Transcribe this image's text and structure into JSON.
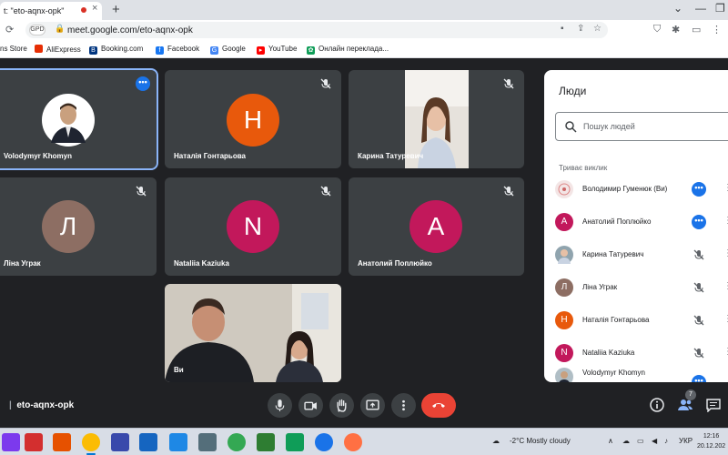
{
  "browser": {
    "tab_title": "t: \"eto-aqnx-opk\"",
    "tab_close": "×",
    "new_tab": "+",
    "url": "meet.google.com/eto-aqnx-opk",
    "site_badge": "GPD",
    "minimize": "—",
    "restore": "❐"
  },
  "bookmarks": [
    {
      "label": "ns Store",
      "color": "#4285f4"
    },
    {
      "label": "AliExpress",
      "color": "#e62e04"
    },
    {
      "label": "Booking.com",
      "color": "#003580"
    },
    {
      "label": "Facebook",
      "color": "#1877f2"
    },
    {
      "label": "Google",
      "color": "#4285f4"
    },
    {
      "label": "YouTube",
      "color": "#ff0000"
    },
    {
      "label": "Онлайн переклада...",
      "color": "#0f9d58"
    }
  ],
  "tiles": [
    {
      "name": "Volodymyr Khomyn",
      "kind": "photo",
      "active": true,
      "menu": "•••"
    },
    {
      "name": "Наталія Гонтарьова",
      "initial": "Н",
      "color": "#e8590c",
      "muted": true
    },
    {
      "name": "Карина Татуревич",
      "kind": "video",
      "muted": true
    },
    {
      "name": "Ліна Уграк",
      "initial": "Л",
      "color": "#8d6e63",
      "muted": true
    },
    {
      "name": "Nataliia Kaziuka",
      "initial": "N",
      "color": "#c2185b",
      "muted": true
    },
    {
      "name": "Анатолий Поплюйко",
      "initial": "А",
      "color": "#c2185b",
      "muted": true
    },
    {
      "name": "Ви",
      "kind": "self-video"
    }
  ],
  "people_panel": {
    "title": "Люди",
    "search_placeholder": "Пошук людей",
    "section": "Триває виклик",
    "people": [
      {
        "name": "Володимир Гуменюк (Ви)",
        "initial": "",
        "color": "#f3e5e5",
        "state": "menu"
      },
      {
        "name": "Анатолий Поплюйко",
        "initial": "А",
        "color": "#c2185b",
        "state": "menu"
      },
      {
        "name": "Карина Татуревич",
        "initial": "",
        "color": "#90a4ae",
        "state": "muted"
      },
      {
        "name": "Ліна Уграк",
        "initial": "Л",
        "color": "#8d6e63",
        "state": "muted"
      },
      {
        "name": "Наталія Гонтарьова",
        "initial": "Н",
        "color": "#e8590c",
        "state": "muted"
      },
      {
        "name": "Nataliia Kaziuka",
        "initial": "N",
        "color": "#c2185b",
        "state": "muted"
      },
      {
        "name": "Volodymyr Khomyn",
        "initial": "",
        "color": "#b0bec5",
        "state": "menu"
      }
    ]
  },
  "meeting": {
    "code": "eto-aqnx-opk",
    "participants_count": "7"
  },
  "taskbar": {
    "weather": "-2°C  Mostly cloudy",
    "lang": "УКР",
    "time": "12:16",
    "date": "20.12.202"
  },
  "colors": {
    "accent": "#1a73e8",
    "end_call": "#ea4335",
    "tile_bg": "#3c4043",
    "stage_bg": "#202124"
  }
}
